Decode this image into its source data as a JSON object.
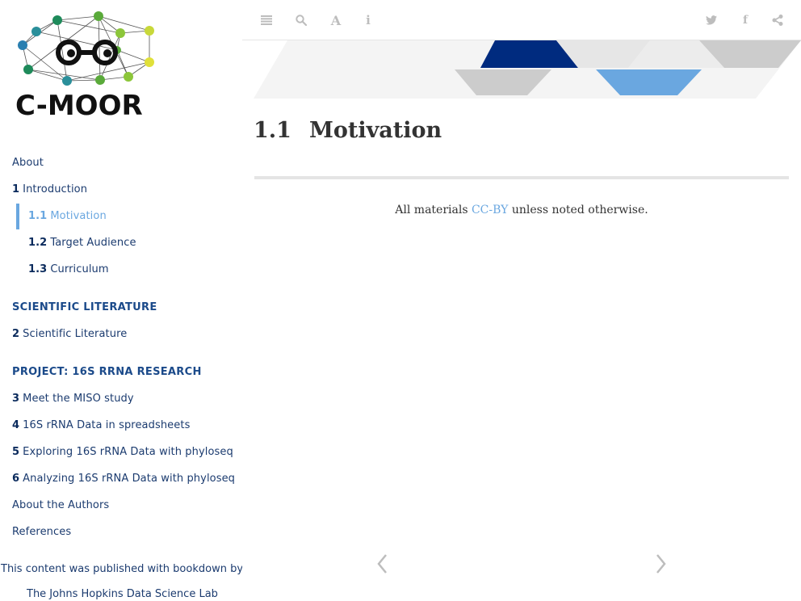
{
  "logo": {
    "text": "C-MOOR"
  },
  "toolbar": {
    "left_icons": [
      "list-icon",
      "search-icon",
      "font-icon",
      "info-icon"
    ],
    "right_icons": [
      "twitter-icon",
      "facebook-icon",
      "share-icon"
    ]
  },
  "sidebar": {
    "items": [
      {
        "label": "About"
      },
      {
        "num": "1",
        "label": "Introduction"
      },
      {
        "num": "1.1",
        "label": "Motivation",
        "active": true
      },
      {
        "num": "1.2",
        "label": "Target Audience"
      },
      {
        "num": "1.3",
        "label": "Curriculum"
      },
      {
        "section": "SCIENTIFIC LITERATURE"
      },
      {
        "num": "2",
        "label": "Scientific Literature"
      },
      {
        "section": "PROJECT: 16S RRNA RESEARCH"
      },
      {
        "num": "3",
        "label": "Meet the MISO study"
      },
      {
        "num": "4",
        "label": "16S rRNA Data in spreadsheets"
      },
      {
        "num": "5",
        "label": "Exploring 16S rRNA Data with phyloseq"
      },
      {
        "num": "6",
        "label": "Analyzing 16S rRNA Data with phyloseq"
      },
      {
        "label": "About the Authors"
      },
      {
        "label": "References"
      }
    ],
    "published_by": "This content was published with bookdown by:",
    "publisher": "The Johns Hopkins Data Science Lab"
  },
  "main": {
    "title_num": "1.1",
    "title": "Motivation",
    "license_prefix": "All materials",
    "license_link": "CC-BY",
    "license_suffix": "unless noted otherwise."
  },
  "colors": {
    "accent": "#6aa7e0",
    "navy": "#002b7f",
    "nav_text": "#1b3b6f"
  }
}
